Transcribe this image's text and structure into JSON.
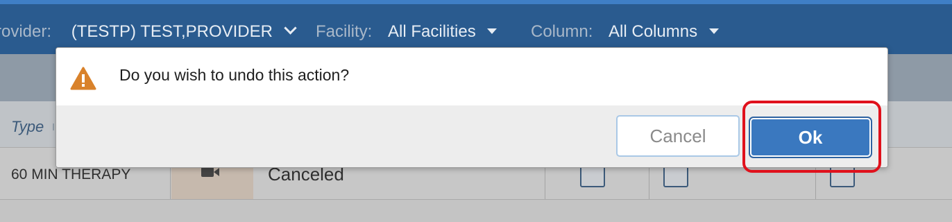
{
  "filters": {
    "provider_label": "rovider:",
    "provider_value": "(TESTP) TEST,PROVIDER",
    "facility_label": "Facility:",
    "facility_value": "All Facilities",
    "column_label": "Column:",
    "column_value": "All Columns"
  },
  "table": {
    "type_header": "Type",
    "row": {
      "type": "60 MIN THERAPY",
      "status": "Canceled"
    }
  },
  "dialog": {
    "message": "Do you wish to undo this action?",
    "cancel_label": "Cancel",
    "ok_label": "Ok",
    "icon": "warning-icon"
  },
  "colors": {
    "header_blue": "#2a5b8f",
    "ok_button": "#3a78bf",
    "warning_orange": "#d9822b",
    "highlight_red": "#e0111c"
  }
}
